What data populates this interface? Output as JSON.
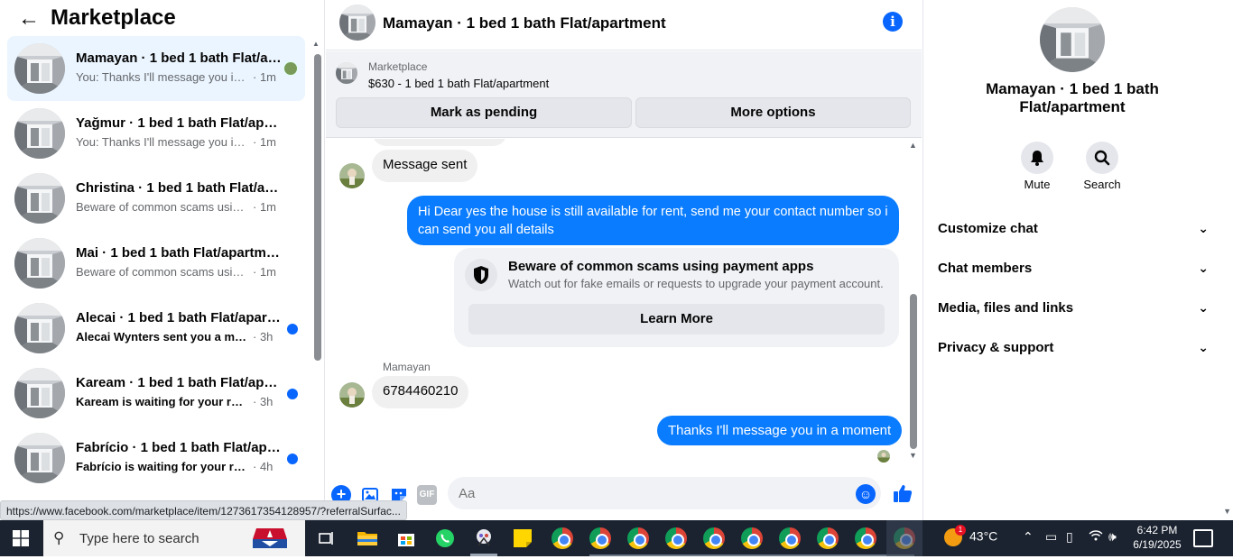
{
  "sidebar": {
    "title": "Marketplace",
    "conversations": [
      {
        "name": "Mamayan · 1 bed 1 bath Flat/apartment",
        "preview": "You: Thanks I'll message you in a moment",
        "time": "· 1m",
        "active": true,
        "unread": false
      },
      {
        "name": "Yağmur · 1 bed 1 bath Flat/apartment",
        "preview": "You: Thanks I'll message you in a moment",
        "time": "· 1m",
        "active": false,
        "unread": false
      },
      {
        "name": "Christina · 1 bed 1 bath Flat/apartment",
        "preview": "Beware of common scams using payment apps",
        "time": "· 1m",
        "active": false,
        "unread": false
      },
      {
        "name": "Mai · 1 bed 1 bath Flat/apartment",
        "preview": "Beware of common scams using payment apps",
        "time": "· 1m",
        "active": false,
        "unread": false
      },
      {
        "name": "Alecai · 1 bed 1 bath Flat/apartment",
        "preview": "Alecai Wynters sent you a message",
        "time": "· 3h",
        "active": false,
        "unread": true
      },
      {
        "name": "Kaream · 1 bed 1 bath Flat/apartment",
        "preview": "Kaream is waiting for your response",
        "time": "· 3h",
        "active": false,
        "unread": true
      },
      {
        "name": "Fabrício · 1 bed 1 bath Flat/apartment",
        "preview": "Fabrício is waiting for your response",
        "time": "· 4h",
        "active": false,
        "unread": true
      }
    ]
  },
  "chat": {
    "title": "Mamayan · 1 bed 1 bath Flat/apartment",
    "listing": {
      "source": "Marketplace",
      "description": "$630 - 1 bed 1 bath Flat/apartment",
      "mark_pending": "Mark as pending",
      "more_options": "More options"
    },
    "messages": {
      "system_sent": "Message sent",
      "outgoing_1": "Hi Dear yes the house is still available for rent, send me your contact number so i can send you all details",
      "scam_title": "Beware of common scams using payment apps",
      "scam_text": "Watch out for fake emails or requests to upgrade your payment account.",
      "learn_more": "Learn More",
      "sender": "Mamayan",
      "incoming_1": "6784460210",
      "outgoing_2": "Thanks I'll message you in a moment"
    },
    "composer": {
      "placeholder": "Aa",
      "gif_label": "GIF"
    }
  },
  "details": {
    "name": "Mamayan · 1 bed 1 bath Flat/apartment",
    "mute": "Mute",
    "search": "Search",
    "sections": [
      "Customize chat",
      "Chat members",
      "Media, files and links",
      "Privacy & support"
    ]
  },
  "status_url": "https://www.facebook.com/marketplace/item/1273617354128957/?referralSurfac...",
  "taskbar": {
    "search_placeholder": "Type here to search",
    "temperature": "43°C",
    "time": "6:42 PM",
    "date": "6/19/2025",
    "weather_badge": "1"
  },
  "colors": {
    "accent": "#0866ff",
    "outgoing_bubble": "#0a7cff",
    "unread_dot": "#0866ff"
  }
}
